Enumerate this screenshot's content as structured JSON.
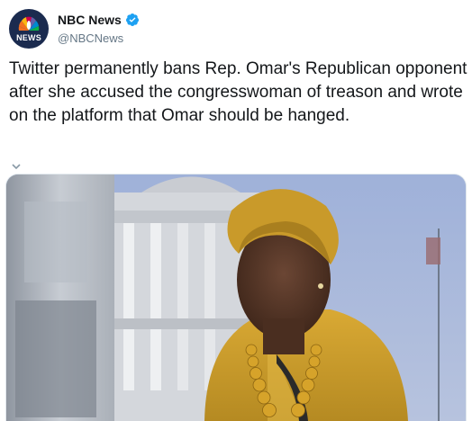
{
  "account": {
    "display_name": "NBC News",
    "handle": "@NBCNews",
    "avatar_text": "NEWS",
    "verified": true
  },
  "tweet": {
    "text": "Twitter permanently bans Rep. Omar's Republican opponent after she accused the congresswoman of treason and wrote on the platform that Omar should be hanged."
  },
  "colors": {
    "verified_blue": "#1da1f2",
    "text_primary": "#14171a",
    "text_secondary": "#657786",
    "avatar_bg": "#1b2b4f"
  },
  "icons": {
    "verified": "verified-badge-icon",
    "caret": "caret-down-icon"
  }
}
